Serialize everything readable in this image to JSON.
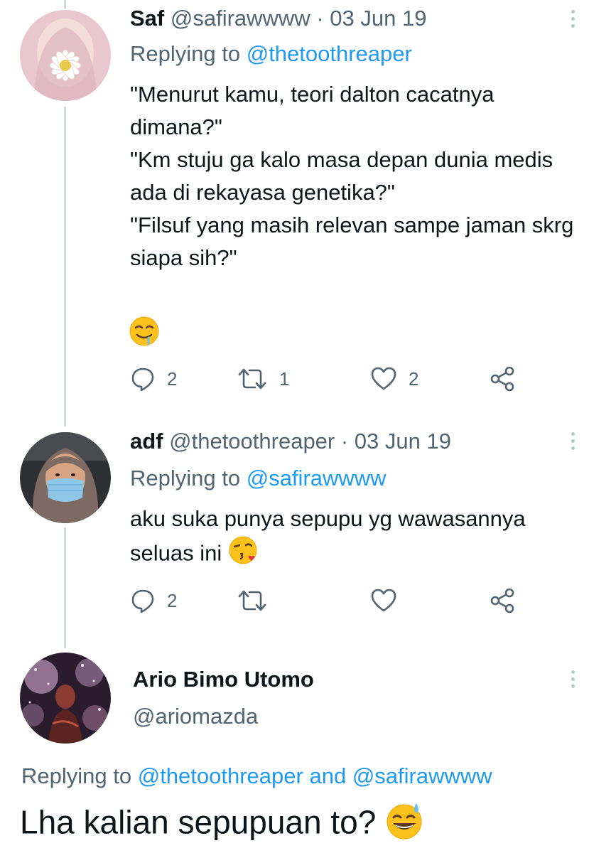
{
  "tweets": [
    {
      "name": "Saf",
      "handle": "@safirawwww",
      "date": "· 03 Jun 19",
      "replying_label": "Replying to",
      "replying_to": "@thetoothreaper",
      "lines": [
        "\"Menurut kamu, teori dalton cacatnya dimana?\"",
        "\"Km stuju ga kalo masa depan dunia medis ada di rekayasa genetika?\"",
        "\"Filsuf yang masih relevan sampe jaman skrg siapa sih?\""
      ],
      "emoji": "drooling-face-emoji",
      "replies": "2",
      "retweets": "1",
      "likes": "2"
    },
    {
      "name": "adf",
      "handle": "@thetoothreaper",
      "date": "· 03 Jun 19",
      "replying_label": "Replying to",
      "replying_to": "@safirawwww",
      "text": "aku suka punya sepupu yg wawasannya seluas ini",
      "emoji": "face-blowing-kiss-emoji",
      "replies": "2",
      "retweets": "",
      "likes": ""
    }
  ],
  "main_tweet": {
    "name": "Ario Bimo Utomo",
    "handle": "@ariomazda",
    "replying_label": "Replying to",
    "replying_to_1": "@thetoothreaper",
    "and_label": "and",
    "replying_to_2": "@safirawwww",
    "text": "Lha kalian sepupuan to?",
    "emoji": "grinning-face-with-sweat-emoji"
  },
  "colors": {
    "link": "#1d9bf0",
    "secondary": "#536471",
    "thread_line": "#cfd9de"
  }
}
